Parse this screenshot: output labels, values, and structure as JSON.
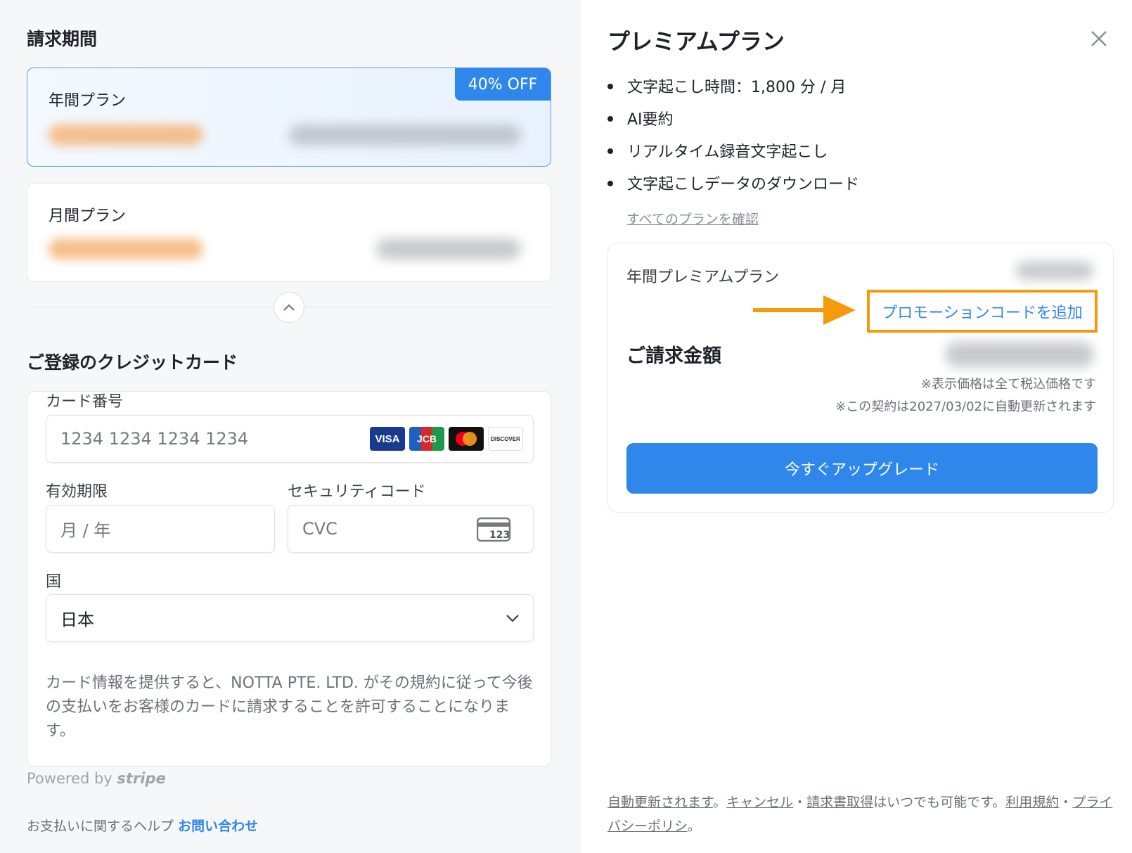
{
  "billing_period": {
    "title": "請求期間",
    "annual_plan": {
      "label": "年間プラン",
      "badge": "40% OFF",
      "selected": true
    },
    "monthly_plan": {
      "label": "月間プラン",
      "selected": false
    }
  },
  "card_section": {
    "title": "ご登録のクレジットカード",
    "card_number": {
      "label": "カード番号",
      "placeholder": "1234 1234 1234 1234"
    },
    "brands": [
      "VISA",
      "JCB",
      "Mastercard",
      "DISCOVER"
    ],
    "expiry": {
      "label": "有効期限",
      "placeholder": "月 / 年"
    },
    "security": {
      "label": "セキュリティコード",
      "placeholder": "CVC",
      "icon_text": "123"
    },
    "country": {
      "label": "国",
      "value": "日本"
    },
    "legal": "カード情報を提供すると、NOTTA PTE. LTD. がその規約に従って今後の支払いをお客様のカードに請求することを許可することになります。",
    "powered_by": "Powered by",
    "powered_brand": "stripe"
  },
  "help": {
    "text": "お支払いに関するヘルプ",
    "link": "お問い合わせ"
  },
  "premium": {
    "title": "プレミアムプラン",
    "features": [
      "文字起こし時間：1,800 分 / 月",
      "AI要約",
      "リアルタイム録音文字起こし",
      "文字起こしデータのダウンロード"
    ],
    "all_plans_link": "すべてのプランを確認"
  },
  "summary": {
    "plan_name": "年間プレミアムプラン",
    "promo_link": "プロモーションコードを追加",
    "billing_label": "ご請求金額",
    "tax_note": "※表示価格は全て税込価格です",
    "renew_note": "※この契約は2027/03/02に自動更新されます",
    "upgrade_button": "今すぐアップグレード"
  },
  "footer": {
    "auto_renew": "自動更新されます",
    "period1": "。",
    "cancel": "キャンセル",
    "sep1": "・",
    "invoice": "請求書取得",
    "anytime": "はいつでも可能です。",
    "terms": "利用規約",
    "sep2": "・",
    "privacy": "プライバシーポリシ",
    "period2": "。"
  },
  "colors": {
    "accent": "#2f87ec",
    "highlight_orange": "#f59a0c",
    "left_bg": "#f6f7f9"
  }
}
